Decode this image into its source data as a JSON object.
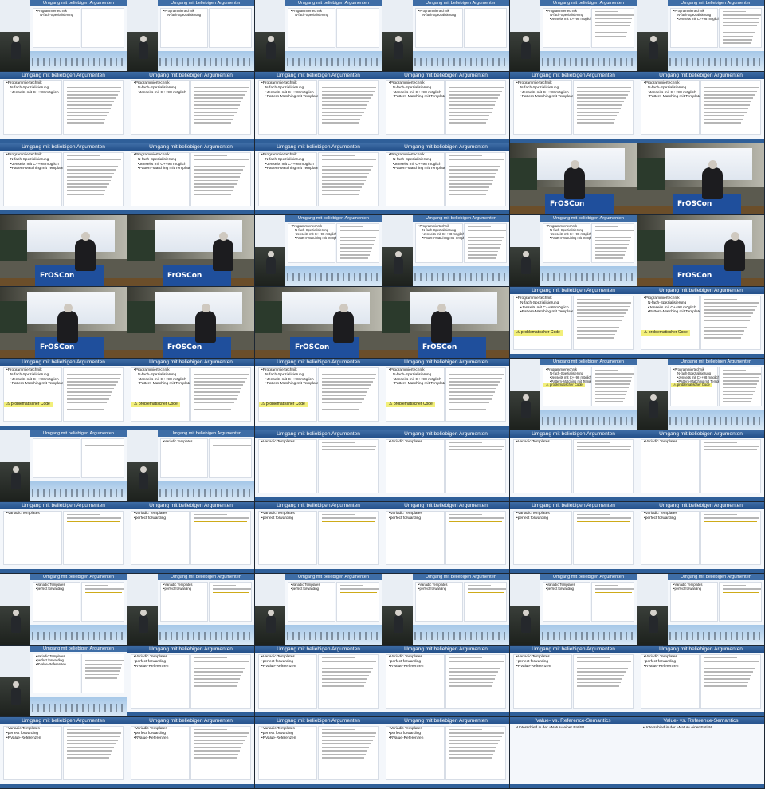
{
  "contact_sheet": {
    "columns": 6,
    "rows": 11
  },
  "slide_titles": {
    "a": "Umgang mit beliebigen Argumenten",
    "b": "Value- vs. Reference-Semantics"
  },
  "branding": {
    "podium_logo": "FrOSCon"
  },
  "bullets": {
    "programmiertechnik": "Programmiertechnik",
    "nfach": "N-fach-Spezialisierung",
    "jenseits": "Jenseits mit C++98 möglich",
    "pattern": "Pattern-Matching mit Templates",
    "problem": "⚠ problematischer Code",
    "variadic": "Variadic Templates",
    "perfect": "perfect forwarding",
    "rvalue": "RValue-Referenzen",
    "unterschied": "Unterschied in der »Natur« einer Entität"
  },
  "frames": [
    {
      "kind": "proj",
      "title": "a",
      "items": [
        "programmiertechnik",
        "nfach"
      ],
      "code": 0
    },
    {
      "kind": "proj",
      "title": "a",
      "items": [
        "programmiertechnik",
        "nfach"
      ],
      "code": 0
    },
    {
      "kind": "proj",
      "title": "a",
      "items": [
        "programmiertechnik",
        "nfach"
      ],
      "code": 0
    },
    {
      "kind": "proj",
      "title": "a",
      "items": [
        "programmiertechnik",
        "nfach"
      ],
      "code": 0
    },
    {
      "kind": "proj",
      "title": "a",
      "items": [
        "programmiertechnik",
        "nfach",
        "jenseits"
      ],
      "code": 8
    },
    {
      "kind": "proj",
      "title": "a",
      "items": [
        "programmiertechnik",
        "nfach",
        "jenseits"
      ],
      "code": 10
    },
    {
      "kind": "slide",
      "title": "a",
      "items": [
        "programmiertechnik",
        "nfach",
        "jenseits"
      ],
      "code": 12
    },
    {
      "kind": "slide",
      "title": "a",
      "items": [
        "programmiertechnik",
        "nfach",
        "jenseits"
      ],
      "code": 12
    },
    {
      "kind": "slide",
      "title": "a",
      "items": [
        "programmiertechnik",
        "nfach",
        "jenseits",
        "pattern"
      ],
      "code": 12
    },
    {
      "kind": "slide",
      "title": "a",
      "items": [
        "programmiertechnik",
        "nfach",
        "jenseits",
        "pattern"
      ],
      "code": 12
    },
    {
      "kind": "slide",
      "title": "a",
      "items": [
        "programmiertechnik",
        "nfach",
        "jenseits",
        "pattern"
      ],
      "code": 12
    },
    {
      "kind": "slide",
      "title": "a",
      "items": [
        "programmiertechnik",
        "nfach",
        "jenseits",
        "pattern"
      ],
      "code": 12
    },
    {
      "kind": "slide",
      "title": "a",
      "items": [
        "programmiertechnik",
        "nfach",
        "jenseits",
        "pattern"
      ],
      "code": 12
    },
    {
      "kind": "slide",
      "title": "a",
      "items": [
        "programmiertechnik",
        "nfach",
        "jenseits",
        "pattern"
      ],
      "code": 12
    },
    {
      "kind": "slide",
      "title": "a",
      "items": [
        "programmiertechnik",
        "nfach",
        "jenseits",
        "pattern"
      ],
      "code": 12
    },
    {
      "kind": "slide",
      "title": "a",
      "items": [
        "programmiertechnik",
        "nfach",
        "jenseits",
        "pattern"
      ],
      "code": 12
    },
    {
      "kind": "cam"
    },
    {
      "kind": "cam"
    },
    {
      "kind": "cam"
    },
    {
      "kind": "cam"
    },
    {
      "kind": "proj",
      "title": "a",
      "items": [
        "programmiertechnik",
        "nfach",
        "jenseits",
        "pattern"
      ],
      "code": 10
    },
    {
      "kind": "proj",
      "title": "a",
      "items": [
        "programmiertechnik",
        "nfach",
        "jenseits",
        "pattern"
      ],
      "code": 10
    },
    {
      "kind": "proj",
      "title": "a",
      "items": [
        "programmiertechnik",
        "nfach",
        "jenseits",
        "pattern"
      ],
      "code": 10
    },
    {
      "kind": "cam"
    },
    {
      "kind": "cam"
    },
    {
      "kind": "cam"
    },
    {
      "kind": "cam"
    },
    {
      "kind": "cam"
    },
    {
      "kind": "slide",
      "title": "a",
      "items": [
        "programmiertechnik",
        "nfach",
        "jenseits",
        "pattern"
      ],
      "code": 12,
      "warn": true
    },
    {
      "kind": "slide",
      "title": "a",
      "items": [
        "programmiertechnik",
        "nfach",
        "jenseits",
        "pattern"
      ],
      "code": 12,
      "warn": true
    },
    {
      "kind": "slide",
      "title": "a",
      "items": [
        "programmiertechnik",
        "nfach",
        "jenseits",
        "pattern"
      ],
      "code": 12,
      "warn": true
    },
    {
      "kind": "slide",
      "title": "a",
      "items": [
        "programmiertechnik",
        "nfach",
        "jenseits",
        "pattern"
      ],
      "code": 12,
      "warn": true
    },
    {
      "kind": "slide",
      "title": "a",
      "items": [
        "programmiertechnik",
        "nfach",
        "jenseits",
        "pattern"
      ],
      "code": 12,
      "warn": true
    },
    {
      "kind": "slide",
      "title": "a",
      "items": [
        "programmiertechnik",
        "nfach",
        "jenseits",
        "pattern"
      ],
      "code": 12,
      "warn": true
    },
    {
      "kind": "proj",
      "title": "a",
      "items": [
        "programmiertechnik",
        "nfach",
        "jenseits",
        "pattern"
      ],
      "code": 10,
      "warn": true
    },
    {
      "kind": "proj",
      "title": "a",
      "items": [
        "programmiertechnik",
        "nfach",
        "jenseits",
        "pattern"
      ],
      "code": 10,
      "warn": true
    },
    {
      "kind": "proj",
      "title": "a",
      "items": [],
      "code": 2
    },
    {
      "kind": "proj",
      "title": "a",
      "items": [
        "variadic"
      ],
      "code": 2
    },
    {
      "kind": "slide",
      "title": "a",
      "items": [
        "variadic"
      ],
      "code": 3
    },
    {
      "kind": "slide",
      "title": "a",
      "items": [
        "variadic"
      ],
      "code": 3
    },
    {
      "kind": "slide",
      "title": "a",
      "items": [
        "variadic"
      ],
      "code": 3
    },
    {
      "kind": "slide",
      "title": "a",
      "items": [
        "variadic"
      ],
      "code": 3
    },
    {
      "kind": "slide",
      "title": "a",
      "items": [
        "variadic"
      ],
      "code": 3,
      "hl": true
    },
    {
      "kind": "slide",
      "title": "a",
      "items": [
        "variadic",
        "perfect"
      ],
      "code": 3,
      "hl": true
    },
    {
      "kind": "slide",
      "title": "a",
      "items": [
        "variadic",
        "perfect"
      ],
      "code": 3,
      "hl": true
    },
    {
      "kind": "slide",
      "title": "a",
      "items": [
        "variadic",
        "perfect"
      ],
      "code": 3,
      "hl": true
    },
    {
      "kind": "slide",
      "title": "a",
      "items": [
        "variadic",
        "perfect"
      ],
      "code": 3,
      "hl": true
    },
    {
      "kind": "slide",
      "title": "a",
      "items": [
        "variadic",
        "perfect"
      ],
      "code": 3,
      "hl": true
    },
    {
      "kind": "proj",
      "title": "a",
      "items": [
        "variadic",
        "perfect"
      ],
      "code": 3,
      "hl": true
    },
    {
      "kind": "proj",
      "title": "a",
      "items": [
        "variadic",
        "perfect"
      ],
      "code": 3,
      "hl": true
    },
    {
      "kind": "proj",
      "title": "a",
      "items": [
        "variadic",
        "perfect"
      ],
      "code": 3,
      "hl": true
    },
    {
      "kind": "proj",
      "title": "a",
      "items": [
        "variadic",
        "perfect"
      ],
      "code": 3,
      "hl": true
    },
    {
      "kind": "proj",
      "title": "a",
      "items": [
        "variadic",
        "perfect"
      ],
      "code": 3,
      "hl": true
    },
    {
      "kind": "proj",
      "title": "a",
      "items": [
        "variadic",
        "perfect"
      ],
      "code": 3,
      "hl": true
    },
    {
      "kind": "proj",
      "title": "a",
      "items": [
        "variadic",
        "perfect",
        "rvalue"
      ],
      "code": 7
    },
    {
      "kind": "slide",
      "title": "a",
      "items": [
        "variadic",
        "perfect",
        "rvalue"
      ],
      "code": 9
    },
    {
      "kind": "slide",
      "title": "a",
      "items": [
        "variadic",
        "perfect",
        "rvalue"
      ],
      "code": 9
    },
    {
      "kind": "slide",
      "title": "a",
      "items": [
        "variadic",
        "perfect",
        "rvalue"
      ],
      "code": 9
    },
    {
      "kind": "slide",
      "title": "a",
      "items": [
        "variadic",
        "perfect",
        "rvalue"
      ],
      "code": 9
    },
    {
      "kind": "slide",
      "title": "a",
      "items": [
        "variadic",
        "perfect",
        "rvalue"
      ],
      "code": 9
    },
    {
      "kind": "slide",
      "title": "a",
      "items": [
        "variadic",
        "perfect",
        "rvalue"
      ],
      "code": 9
    },
    {
      "kind": "slide",
      "title": "a",
      "items": [
        "variadic",
        "perfect",
        "rvalue"
      ],
      "code": 9
    },
    {
      "kind": "slide",
      "title": "a",
      "items": [
        "variadic",
        "perfect",
        "rvalue"
      ],
      "code": 9
    },
    {
      "kind": "slide",
      "title": "a",
      "items": [
        "variadic",
        "perfect",
        "rvalue"
      ],
      "code": 9
    },
    {
      "kind": "slide",
      "title": "b",
      "items": [
        "unterschied"
      ],
      "code": 0,
      "wide": true
    },
    {
      "kind": "slide",
      "title": "b",
      "items": [
        "unterschied"
      ],
      "code": 0,
      "wide": true
    }
  ]
}
